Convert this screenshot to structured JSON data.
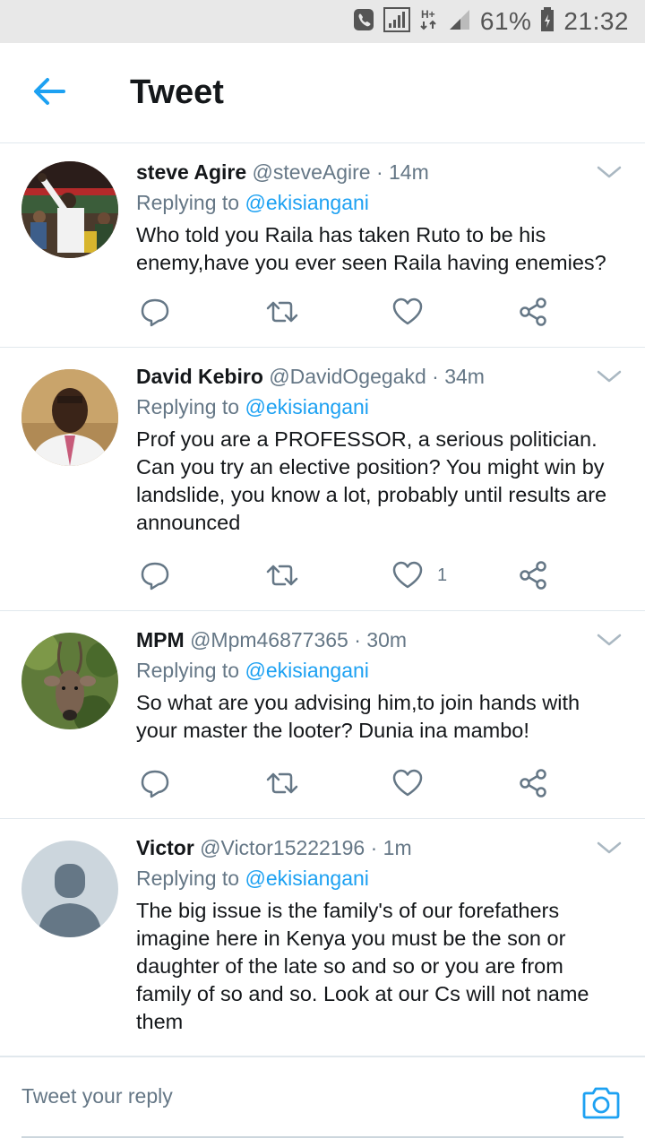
{
  "status_bar": {
    "battery": "61%",
    "time": "21:32",
    "network": "H+"
  },
  "header": {
    "title": "Tweet"
  },
  "tweets": [
    {
      "name": "steve Agire",
      "handle": "@steveAgire",
      "time": "· 14m",
      "replying_label": "Replying to",
      "replying_to": "@ekisiangani",
      "text": "Who told you Raila has taken Ruto to be his enemy,have you ever seen Raila having enemies?",
      "likes": ""
    },
    {
      "name": "David Kebiro",
      "handle": "@DavidOgegakd",
      "time": "· 34m",
      "replying_label": "Replying to",
      "replying_to": "@ekisiangani",
      "text": "Prof you are a PROFESSOR, a serious politician. Can you try an elective position? You might win by landslide, you know a lot, probably until results are announced",
      "likes": "1"
    },
    {
      "name": "MPM",
      "handle": "@Mpm46877365",
      "time": "· 30m",
      "replying_label": "Replying to",
      "replying_to": "@ekisiangani",
      "text": "So what are you advising him,to join hands with your master the looter? Dunia ina mambo!",
      "likes": ""
    },
    {
      "name": "Victor",
      "handle": "@Victor15222196",
      "time": "· 1m",
      "replying_label": "Replying to",
      "replying_to": "@ekisiangani",
      "text": "The big issue is the family's of our forefathers imagine here in Kenya you must be the son or daughter of the late so and so or you are from family of so and so. Look at our Cs will not name them",
      "likes": ""
    }
  ],
  "reply_bar": {
    "placeholder": "Tweet your reply"
  },
  "colors": {
    "accent": "#1da1f2",
    "secondary_text": "#657786",
    "divider": "#e1e8ed"
  },
  "icons": [
    "back-arrow-icon",
    "reply-icon",
    "retweet-icon",
    "like-icon",
    "share-icon",
    "chevron-down-icon",
    "camera-icon"
  ]
}
